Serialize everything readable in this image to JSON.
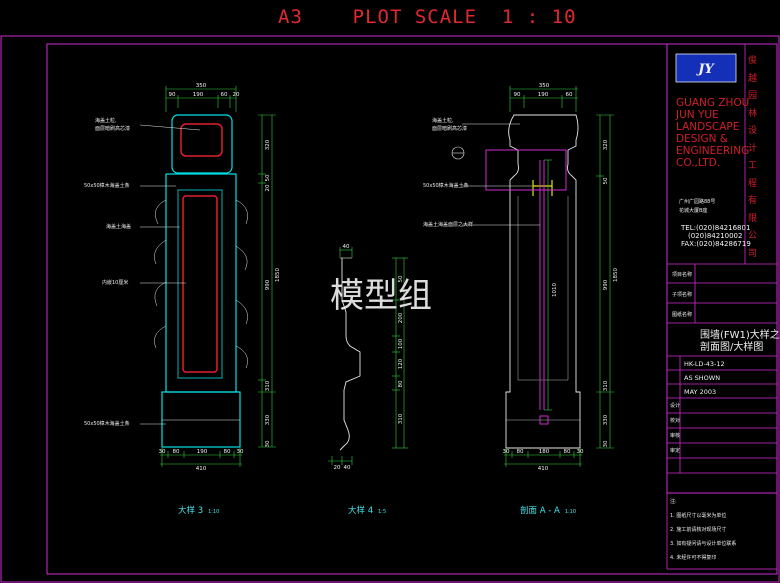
{
  "header": {
    "plot_scale": "A3    PLOT SCALE  1 : 10"
  },
  "watermark": "模型组",
  "title_block": {
    "company_en": [
      "GUANG ZHOU",
      "JUN YUE",
      "LANDSCAPE",
      "DESIGN &",
      "ENGINEERING",
      "CO.,LTD."
    ],
    "company_cn": "俊越园林设计工程有限公司",
    "address": [
      "广州广园路88号",
      "花城大厦B座"
    ],
    "tel": [
      "TEL:(020)84216801",
      "(020)84210002",
      "FAX:(020)84286719"
    ],
    "fields": [
      "项目名称",
      "子项名称",
      "图纸名称"
    ],
    "drawing_title": [
      "围墙(FW1)大样之",
      "剖面图/大样图"
    ],
    "drawing_no": "HK-LD-43-12",
    "scale": "AS SHOWN",
    "date": "MAY 2003",
    "rows": [
      "设计",
      "校对",
      "审核",
      "审定"
    ],
    "notes": [
      "注:",
      "1. 图纸尺寸以毫米为单位",
      "2. 施工前请核对现场尺寸",
      "3. 如有疑问请与设计单位联系",
      "4. 未经许可不得复印"
    ]
  },
  "captions": {
    "detail3": "大样 3",
    "detail3_scale": "1:10",
    "detail4": "大样 4",
    "detail4_scale": "1:5",
    "section": "剖面 A - A",
    "section_scale": "1:10"
  },
  "labels_d3": [
    "海盖土粒,",
    "面层暗刷高芯漆",
    "50x50樟木海盖土条",
    "海盖土海盖",
    "内嵌10厘米",
    "50x50樟木海盖土条"
  ],
  "labels_sec": [
    "海盖土粒,",
    "面层暗刷高芯漆",
    "50x50樟木海盖土条",
    "海盖土海盖面层之大样"
  ],
  "dims_d3": {
    "top": [
      "350",
      "90",
      "190",
      "60",
      "20"
    ],
    "bottom": [
      "410",
      "30",
      "80",
      "190",
      "80",
      "30"
    ],
    "right": [
      "320",
      "1850",
      "50",
      "20",
      "990",
      "310",
      "330",
      "30"
    ]
  },
  "dims_d4": {
    "top": "40",
    "bottom": [
      "20",
      "40"
    ],
    "right": [
      "50",
      "200",
      "100",
      "120",
      "310",
      "80"
    ]
  },
  "dims_sec": {
    "top": [
      "350",
      "90",
      "190",
      "60"
    ],
    "bottom": [
      "410",
      "30",
      "80",
      "180",
      "80",
      "30"
    ],
    "right": [
      "320",
      "1850",
      "50",
      "990",
      "1010",
      "310",
      "330",
      "30"
    ]
  },
  "colors": {
    "frame": "#d12bd3",
    "header_red": "#e0282f",
    "cyan": "#00e1e8",
    "green": "#2fd13a",
    "red": "#e0202a",
    "yellow": "#e6e315",
    "caption": "#3fe7ef"
  }
}
